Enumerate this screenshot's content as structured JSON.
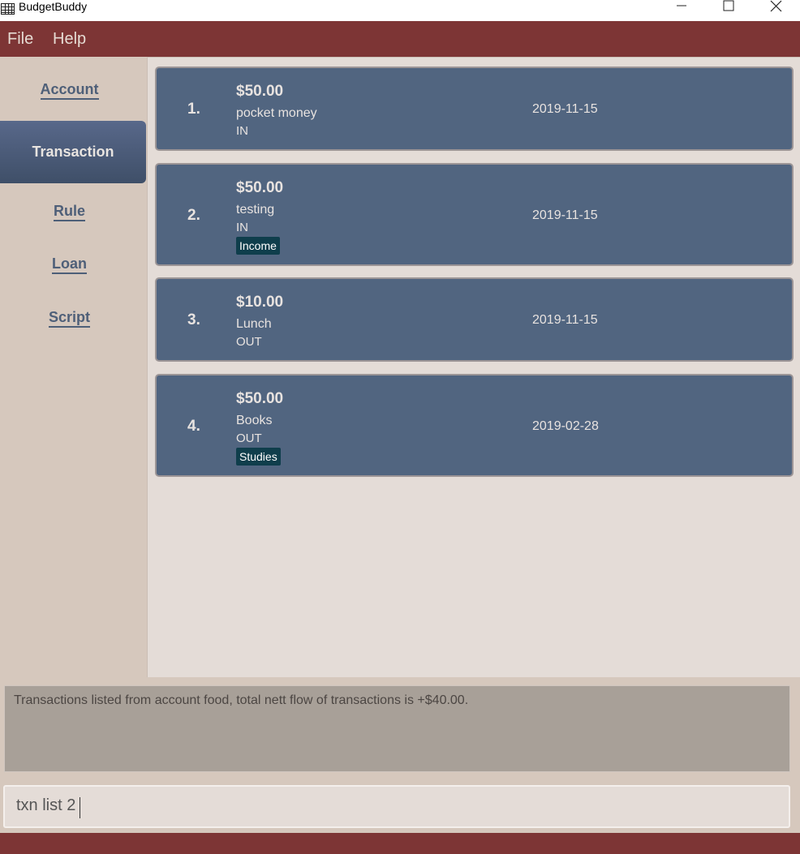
{
  "window": {
    "title": "BudgetBuddy",
    "controls": {
      "minimize": "minimize-icon",
      "maximize": "maximize-icon",
      "close": "close-icon"
    }
  },
  "menu": {
    "file": "File",
    "help": "Help"
  },
  "sidebar": {
    "items": [
      {
        "label": "Account",
        "active": false
      },
      {
        "label": "Transaction",
        "active": true
      },
      {
        "label": "Rule",
        "active": false
      },
      {
        "label": "Loan",
        "active": false
      },
      {
        "label": "Script",
        "active": false
      }
    ]
  },
  "transactions": [
    {
      "index": "1.",
      "amount": "$50.00",
      "description": "pocket money",
      "direction": "IN",
      "date": "2019-11-15",
      "tag": ""
    },
    {
      "index": "2.",
      "amount": "$50.00",
      "description": "testing",
      "direction": "IN",
      "date": "2019-11-15",
      "tag": "Income"
    },
    {
      "index": "3.",
      "amount": "$10.00",
      "description": "Lunch",
      "direction": "OUT",
      "date": "2019-11-15",
      "tag": ""
    },
    {
      "index": "4.",
      "amount": "$50.00",
      "description": "Books",
      "direction": "OUT",
      "date": "2019-02-28",
      "tag": "Studies"
    }
  ],
  "result": {
    "text": "Transactions listed from account food, total nett flow of transactions is +$40.00."
  },
  "command": {
    "value": "txn list 2"
  },
  "colors": {
    "menubar": "#7d3535",
    "sidebar": "#d6c8bd",
    "card": "#516580",
    "tag": "#0f3e4c",
    "panel": "#e4dcd7"
  }
}
